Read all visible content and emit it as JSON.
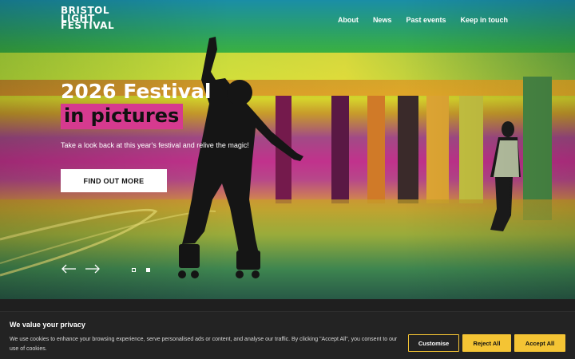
{
  "brand": {
    "logo_lines": [
      "BRISTOL",
      "LIGHT",
      "FESTIVAL"
    ]
  },
  "nav": {
    "items": [
      "About",
      "News",
      "Past events",
      "Keep in touch"
    ]
  },
  "hero": {
    "headline": "2026 Festival",
    "highlight": "in pictures",
    "subtext": "Take a look back at this year's festival and relive the magic!",
    "cta_label": "FIND OUT MORE",
    "slide_count": 2,
    "active_slide": 2,
    "icons": [
      "arrow-left-icon",
      "arrow-right-icon"
    ]
  },
  "cookie": {
    "title": "We value your privacy",
    "text": "We use cookies to enhance your browsing experience, serve personalised ads or content, and analyse our traffic. By clicking \"Accept All\", you consent to our use of cookies.",
    "customise_label": "Customise",
    "reject_label": "Reject All",
    "accept_label": "Accept All"
  },
  "colors": {
    "highlight": "#d63a8f",
    "accent": "#f4c434",
    "banner_bg": "#232323"
  }
}
